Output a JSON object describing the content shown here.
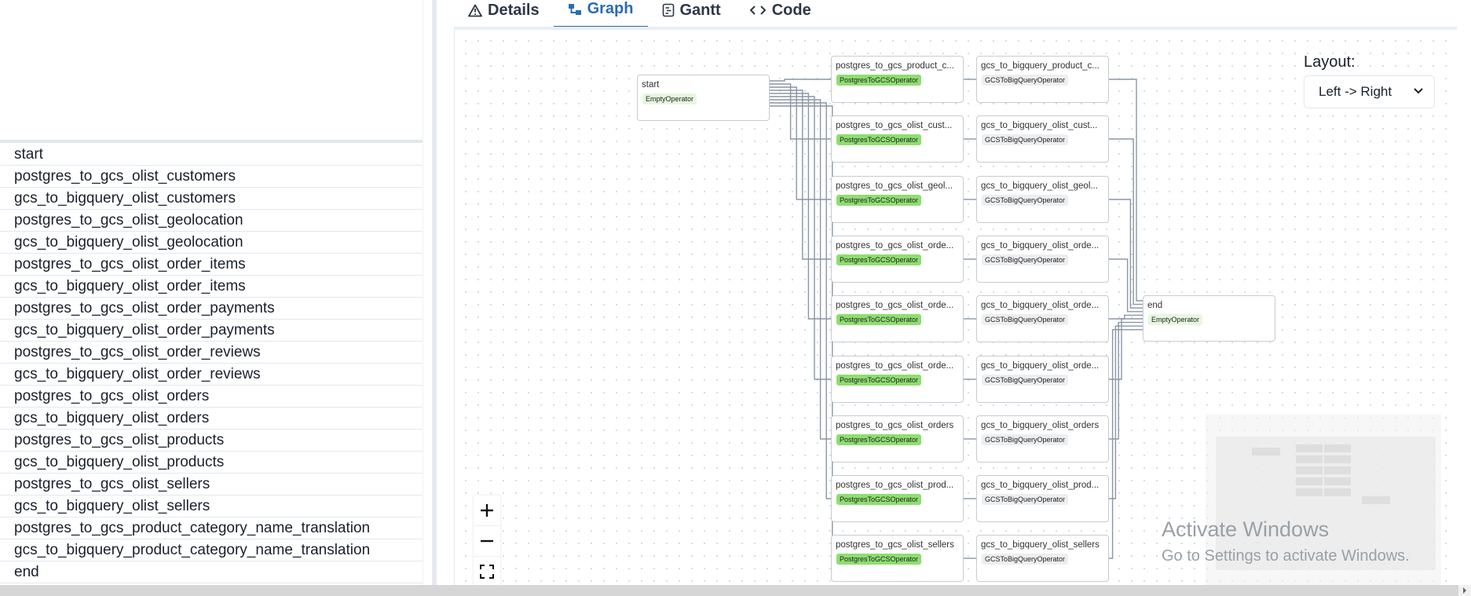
{
  "tabs": [
    {
      "label": "Details",
      "icon": "warning-triangle-icon"
    },
    {
      "label": "Graph",
      "icon": "graph-icon",
      "active": true
    },
    {
      "label": "Gantt",
      "icon": "gantt-icon"
    },
    {
      "label": "Code",
      "icon": "code-icon"
    }
  ],
  "task_list": [
    "start",
    "postgres_to_gcs_olist_customers",
    "gcs_to_bigquery_olist_customers",
    "postgres_to_gcs_olist_geolocation",
    "gcs_to_bigquery_olist_geolocation",
    "postgres_to_gcs_olist_order_items",
    "gcs_to_bigquery_olist_order_items",
    "postgres_to_gcs_olist_order_payments",
    "gcs_to_bigquery_olist_order_payments",
    "postgres_to_gcs_olist_order_reviews",
    "gcs_to_bigquery_olist_order_reviews",
    "postgres_to_gcs_olist_orders",
    "gcs_to_bigquery_olist_orders",
    "postgres_to_gcs_olist_products",
    "gcs_to_bigquery_olist_products",
    "postgres_to_gcs_olist_sellers",
    "gcs_to_bigquery_olist_sellers",
    "postgres_to_gcs_product_category_name_translation",
    "gcs_to_bigquery_product_category_name_translation",
    "end"
  ],
  "graph": {
    "start": {
      "name": "start",
      "operator": "EmptyOperator"
    },
    "end": {
      "name": "end",
      "operator": "EmptyOperator"
    },
    "rows": [
      {
        "pg": "postgres_to_gcs_product_c...",
        "gcs": "gcs_to_bigquery_product_c..."
      },
      {
        "pg": "postgres_to_gcs_olist_cust...",
        "gcs": "gcs_to_bigquery_olist_cust..."
      },
      {
        "pg": "postgres_to_gcs_olist_geol...",
        "gcs": "gcs_to_bigquery_olist_geol..."
      },
      {
        "pg": "postgres_to_gcs_olist_orde...",
        "gcs": "gcs_to_bigquery_olist_orde..."
      },
      {
        "pg": "postgres_to_gcs_olist_orde...",
        "gcs": "gcs_to_bigquery_olist_orde..."
      },
      {
        "pg": "postgres_to_gcs_olist_orde...",
        "gcs": "gcs_to_bigquery_olist_orde..."
      },
      {
        "pg": "postgres_to_gcs_olist_orders",
        "gcs": "gcs_to_bigquery_olist_orders"
      },
      {
        "pg": "postgres_to_gcs_olist_prod...",
        "gcs": "gcs_to_bigquery_olist_prod..."
      },
      {
        "pg": "postgres_to_gcs_olist_sellers",
        "gcs": "gcs_to_bigquery_olist_sellers"
      }
    ],
    "pg_operator": "PostgresToGCSOperator",
    "gcs_operator": "GCSToBigQueryOperator"
  },
  "layout": {
    "label": "Layout:",
    "value": "Left -> Right"
  },
  "zoom": {
    "in": "+",
    "out": "−"
  },
  "watermark": {
    "title": "Activate Windows",
    "subtitle": "Go to Settings to activate Windows."
  },
  "colors": {
    "accent": "#2b6cb0",
    "pg_operator": "#8ede70",
    "gcs_operator": "#edeef0",
    "empty_operator": "#e6f7df",
    "edge": "#8a96a6"
  }
}
